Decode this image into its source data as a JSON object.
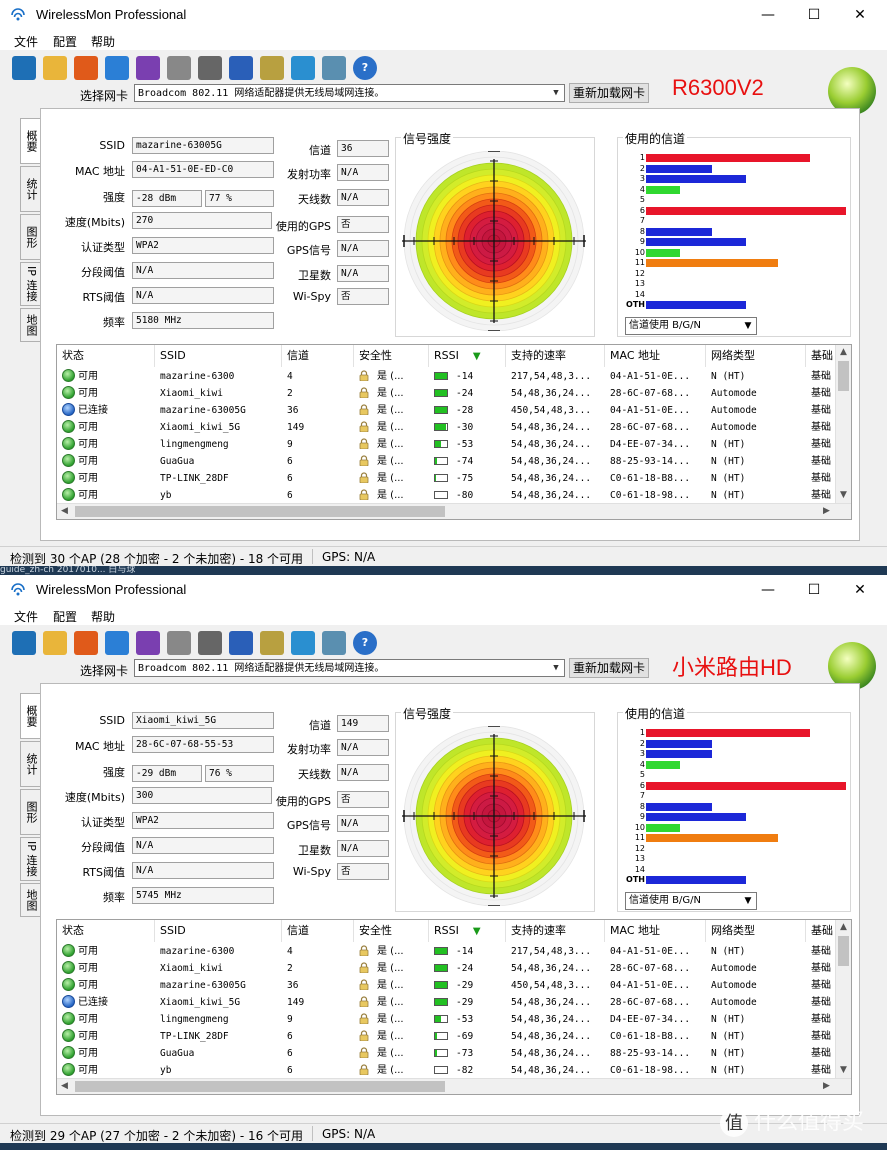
{
  "app": {
    "title": "WirelessMon Professional",
    "menu": [
      "文件",
      "配置",
      "帮助"
    ],
    "adapter_label": "选择网卡",
    "adapter_value": "Broadcom 802.11 网络适配器提供无线局域网连接。",
    "reload_label": "重新加载网卡",
    "window_buttons": {
      "min": "—",
      "max": "☐",
      "close": "✕"
    }
  },
  "tabs": [
    "概要",
    "统计",
    "图形",
    "IP 连接",
    "地图"
  ],
  "labels": {
    "ssid": "SSID",
    "mac": "MAC 地址",
    "strength": "强度",
    "speed": "速度(Mbits)",
    "auth": "认证类型",
    "frag": "分段阈值",
    "rts": "RTS阈值",
    "freq": "频率",
    "channel": "信道",
    "txpower": "发射功率",
    "antennas": "天线数",
    "gps_used": "使用的GPS",
    "gps_signal": "GPS信号",
    "satellites": "卫星数",
    "wispy": "Wi-Spy",
    "signal_strength": "信号强度",
    "channels_used": "使用的信道",
    "channel_select": "信道使用 B/G/N",
    "channel_numbers": [
      "1",
      "2",
      "3",
      "4",
      "5",
      "6",
      "7",
      "8",
      "9",
      "10",
      "11",
      "12",
      "13",
      "14",
      "OTH"
    ]
  },
  "columns": [
    "状态",
    "SSID",
    "信道",
    "安全性",
    "RSSI",
    "支持的速率",
    "MAC 地址",
    "网络类型",
    "基础"
  ],
  "colors": {
    "red": "#e8152a",
    "blue": "#1c28d8",
    "green": "#30d830",
    "orange": "#f07d10",
    "router_label": "#e81010"
  },
  "windows": [
    {
      "router_label": "R6300V2",
      "info": {
        "ssid": "mazarine-63005G",
        "mac": "04-A1-51-0E-ED-C0",
        "strength_dbm": "-28 dBm",
        "strength_pct": "77 %",
        "speed": "270",
        "auth": "WPA2",
        "frag": "N/A",
        "rts": "N/A",
        "freq": "5180 MHz",
        "channel": "36",
        "txpower": "N/A",
        "antennas": "N/A",
        "gps_used": "否",
        "gps_signal": "N/A",
        "satellites": "N/A",
        "wispy": "否"
      },
      "channel_usage": [
        {
          "ch": "1",
          "color": "red",
          "level": 0.82
        },
        {
          "ch": "2",
          "color": "blue",
          "level": 0.33
        },
        {
          "ch": "3",
          "color": "blue",
          "level": 0.5
        },
        {
          "ch": "4",
          "color": "green",
          "level": 0.17
        },
        {
          "ch": "5",
          "color": "",
          "level": 0
        },
        {
          "ch": "6",
          "color": "red",
          "level": 1.0
        },
        {
          "ch": "7",
          "color": "",
          "level": 0
        },
        {
          "ch": "8",
          "color": "blue",
          "level": 0.33
        },
        {
          "ch": "9",
          "color": "blue",
          "level": 0.5
        },
        {
          "ch": "10",
          "color": "green",
          "level": 0.17
        },
        {
          "ch": "11",
          "color": "orange",
          "level": 0.66
        },
        {
          "ch": "12",
          "color": "",
          "level": 0
        },
        {
          "ch": "13",
          "color": "",
          "level": 0
        },
        {
          "ch": "14",
          "color": "",
          "level": 0
        },
        {
          "ch": "OTH",
          "color": "blue",
          "level": 0.5
        }
      ],
      "rows": [
        {
          "icon": "green",
          "status": "可用",
          "ssid": "mazarine-6300",
          "channel": "4",
          "security": "是 (...",
          "rssi_level": 1.0,
          "rssi": "-14",
          "rates": "217,54,48,3...",
          "mac": "04-A1-51-0E...",
          "type": "N (HT)",
          "base": "基础"
        },
        {
          "icon": "green",
          "status": "可用",
          "ssid": "Xiaomi_kiwi",
          "channel": "2",
          "security": "是 (...",
          "rssi_level": 1.0,
          "rssi": "-24",
          "rates": "54,48,36,24...",
          "mac": "28-6C-07-68...",
          "type": "Automode",
          "base": "基础"
        },
        {
          "icon": "blue",
          "status": "已连接",
          "ssid": "mazarine-63005G",
          "channel": "36",
          "security": "是 (...",
          "rssi_level": 1.0,
          "rssi": "-28",
          "rates": "450,54,48,3...",
          "mac": "04-A1-51-0E...",
          "type": "Automode",
          "base": "基础"
        },
        {
          "icon": "green",
          "status": "可用",
          "ssid": "Xiaomi_kiwi_5G",
          "channel": "149",
          "security": "是 (...",
          "rssi_level": 0.9,
          "rssi": "-30",
          "rates": "54,48,36,24...",
          "mac": "28-6C-07-68...",
          "type": "Automode",
          "base": "基础"
        },
        {
          "icon": "green",
          "status": "可用",
          "ssid": "lingmengmeng",
          "channel": "9",
          "security": "是 (...",
          "rssi_level": 0.5,
          "rssi": "-53",
          "rates": "54,48,36,24...",
          "mac": "D4-EE-07-34...",
          "type": "N (HT)",
          "base": "基础"
        },
        {
          "icon": "green",
          "status": "可用",
          "ssid": "GuaGua",
          "channel": "6",
          "security": "是 (...",
          "rssi_level": 0.15,
          "rssi": "-74",
          "rates": "54,48,36,24...",
          "mac": "88-25-93-14...",
          "type": "N (HT)",
          "base": "基础"
        },
        {
          "icon": "green",
          "status": "可用",
          "ssid": "TP-LINK_28DF",
          "channel": "6",
          "security": "是 (...",
          "rssi_level": 0.1,
          "rssi": "-75",
          "rates": "54,48,36,24...",
          "mac": "C0-61-18-B8...",
          "type": "N (HT)",
          "base": "基础"
        },
        {
          "icon": "green",
          "status": "可用",
          "ssid": "yb",
          "channel": "6",
          "security": "是 (...",
          "rssi_level": 0.0,
          "rssi": "-80",
          "rates": "54,48,36,24...",
          "mac": "C0-61-18-98...",
          "type": "N (HT)",
          "base": "基础"
        }
      ],
      "status_text": "检测到 30 个AP (28 个加密 - 2 个未加密) - 18 个可用",
      "gps_text": "GPS: N/A"
    },
    {
      "router_label": "小米路由HD",
      "info": {
        "ssid": "Xiaomi_kiwi_5G",
        "mac": "28-6C-07-68-55-53",
        "strength_dbm": "-29 dBm",
        "strength_pct": "76 %",
        "speed": "300",
        "auth": "WPA2",
        "frag": "N/A",
        "rts": "N/A",
        "freq": "5745 MHz",
        "channel": "149",
        "txpower": "N/A",
        "antennas": "N/A",
        "gps_used": "否",
        "gps_signal": "N/A",
        "satellites": "N/A",
        "wispy": "否"
      },
      "channel_usage": [
        {
          "ch": "1",
          "color": "red",
          "level": 0.82
        },
        {
          "ch": "2",
          "color": "blue",
          "level": 0.33
        },
        {
          "ch": "3",
          "color": "blue",
          "level": 0.33
        },
        {
          "ch": "4",
          "color": "green",
          "level": 0.17
        },
        {
          "ch": "5",
          "color": "",
          "level": 0
        },
        {
          "ch": "6",
          "color": "red",
          "level": 1.0
        },
        {
          "ch": "7",
          "color": "",
          "level": 0
        },
        {
          "ch": "8",
          "color": "blue",
          "level": 0.33
        },
        {
          "ch": "9",
          "color": "blue",
          "level": 0.5
        },
        {
          "ch": "10",
          "color": "green",
          "level": 0.17
        },
        {
          "ch": "11",
          "color": "orange",
          "level": 0.66
        },
        {
          "ch": "12",
          "color": "",
          "level": 0
        },
        {
          "ch": "13",
          "color": "",
          "level": 0
        },
        {
          "ch": "14",
          "color": "",
          "level": 0
        },
        {
          "ch": "OTH",
          "color": "blue",
          "level": 0.5
        }
      ],
      "rows": [
        {
          "icon": "green",
          "status": "可用",
          "ssid": "mazarine-6300",
          "channel": "4",
          "security": "是 (...",
          "rssi_level": 1.0,
          "rssi": "-14",
          "rates": "217,54,48,3...",
          "mac": "04-A1-51-0E...",
          "type": "N (HT)",
          "base": "基础"
        },
        {
          "icon": "green",
          "status": "可用",
          "ssid": "Xiaomi_kiwi",
          "channel": "2",
          "security": "是 (...",
          "rssi_level": 1.0,
          "rssi": "-24",
          "rates": "54,48,36,24...",
          "mac": "28-6C-07-68...",
          "type": "Automode",
          "base": "基础"
        },
        {
          "icon": "green",
          "status": "可用",
          "ssid": "mazarine-63005G",
          "channel": "36",
          "security": "是 (...",
          "rssi_level": 1.0,
          "rssi": "-29",
          "rates": "450,54,48,3...",
          "mac": "04-A1-51-0E...",
          "type": "Automode",
          "base": "基础"
        },
        {
          "icon": "blue",
          "status": "已连接",
          "ssid": "Xiaomi_kiwi_5G",
          "channel": "149",
          "security": "是 (...",
          "rssi_level": 1.0,
          "rssi": "-29",
          "rates": "54,48,36,24...",
          "mac": "28-6C-07-68...",
          "type": "Automode",
          "base": "基础"
        },
        {
          "icon": "green",
          "status": "可用",
          "ssid": "lingmengmeng",
          "channel": "9",
          "security": "是 (...",
          "rssi_level": 0.5,
          "rssi": "-53",
          "rates": "54,48,36,24...",
          "mac": "D4-EE-07-34...",
          "type": "N (HT)",
          "base": "基础"
        },
        {
          "icon": "green",
          "status": "可用",
          "ssid": "TP-LINK_28DF",
          "channel": "6",
          "security": "是 (...",
          "rssi_level": 0.2,
          "rssi": "-69",
          "rates": "54,48,36,24...",
          "mac": "C0-61-18-B8...",
          "type": "N (HT)",
          "base": "基础"
        },
        {
          "icon": "green",
          "status": "可用",
          "ssid": "GuaGua",
          "channel": "6",
          "security": "是 (...",
          "rssi_level": 0.15,
          "rssi": "-73",
          "rates": "54,48,36,24...",
          "mac": "88-25-93-14...",
          "type": "N (HT)",
          "base": "基础"
        },
        {
          "icon": "green",
          "status": "可用",
          "ssid": "yb",
          "channel": "6",
          "security": "是 (...",
          "rssi_level": 0.0,
          "rssi": "-82",
          "rates": "54,48,36,24...",
          "mac": "C0-61-18-98...",
          "type": "N (HT)",
          "base": "基础"
        }
      ],
      "status_text": "检测到 29 个AP (27 个加密 - 2 个未加密) - 16 个可用",
      "gps_text": "GPS: N/A"
    }
  ],
  "taskbar_text": "guide_zh-ch            2017010...        白与球",
  "watermark": "什么值得买",
  "watermark_glyph": "值"
}
